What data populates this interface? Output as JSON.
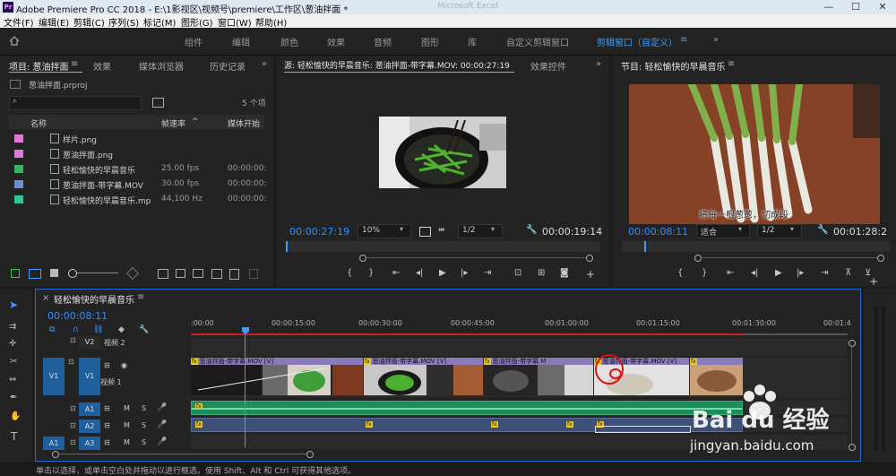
{
  "window": {
    "title": "Adobe Premiere Pro CC 2018 - E:\\1影视区\\视频号\\premiere\\工作区\\葱油拌面 *",
    "ghost_title": "Microsoft Excel",
    "app_icon": "Pr",
    "minimize": "—",
    "maximize": "☐",
    "close": "✕"
  },
  "menu": [
    "文件(F)",
    "编辑(E)",
    "剪辑(C)",
    "序列(S)",
    "标记(M)",
    "图形(G)",
    "窗口(W)",
    "帮助(H)"
  ],
  "workspaces": {
    "home_icon": "home-icon",
    "items": [
      "组件",
      "编辑",
      "颜色",
      "效果",
      "音频",
      "图形",
      "库",
      "自定义剪辑窗口",
      "剪辑窗口（自定义）"
    ],
    "active": "剪辑窗口（自定义）",
    "menu_glyph": "≡",
    "more": "»"
  },
  "project_panel": {
    "tabs": [
      "项目: 葱油拌面",
      "效果",
      "媒体浏览器",
      "历史记录"
    ],
    "tab_menu": "≡",
    "more": "»",
    "project_file": "葱油拌面.prproj",
    "search_placeholder": "",
    "item_count": "5 个项",
    "columns": {
      "name": "名称",
      "framerate": "帧速率",
      "sort": "^",
      "media_start": "媒体开始"
    },
    "items": [
      {
        "color": "#e07ad9",
        "name": "样片.png",
        "fps": "",
        "start": ""
      },
      {
        "color": "#e07ad9",
        "name": "葱油拌面.png",
        "fps": "",
        "start": ""
      },
      {
        "color": "#3bb35c",
        "name": "轻松愉快的早晨音乐",
        "fps": "25.00 fps",
        "start": "00:00:00:"
      },
      {
        "color": "#6f8fd4",
        "name": "葱油拌面-带字幕.MOV",
        "fps": "30.00 fps",
        "start": "00:00:00:"
      },
      {
        "color": "#2fc79a",
        "name": "轻松愉快的早晨音乐.mp",
        "fps": "44,100 Hz",
        "start": "00:00:00:"
      }
    ]
  },
  "source_monitor": {
    "tab": "源: 轻松愉快的早晨音乐: 葱油拌面-带字幕.MOV: 00:00:27:19",
    "tab2": "效果控件",
    "more": "»",
    "timecode": "00:00:27:19",
    "zoom": "10%",
    "resolution": "1/2",
    "duration": "00:00:19:14"
  },
  "program_monitor": {
    "tab": "节目: 轻松愉快的早晨音乐",
    "menu": "≡",
    "timecode": "00:00:08:11",
    "fit": "适合",
    "resolution": "1/2",
    "duration": "00:01:28:2",
    "subtitle": "将每一根葱葱，切成段"
  },
  "timeline": {
    "tab": "轻松愉快的早晨音乐",
    "close": "×",
    "menu": "≡",
    "timecode": "00:00:08:11",
    "ruler": [
      ":00:00",
      "00:00:15:00",
      "00:00:30:00",
      "00:00:45:00",
      "00:01:00:00",
      "00:01:15:00",
      "00:01:30:00",
      "00:01:4"
    ],
    "tracks_video": [
      {
        "target": "",
        "name": "V2",
        "label": "视频 2"
      },
      {
        "target": "V1",
        "name": "V1",
        "label": "视频 1"
      }
    ],
    "tracks_audio": [
      {
        "target": "",
        "name": "A1",
        "m": "M",
        "s": "S"
      },
      {
        "target": "",
        "name": "A2",
        "m": "M",
        "s": "S"
      },
      {
        "target": "A1",
        "name": "A3",
        "m": "M",
        "s": "S"
      }
    ],
    "clip_label": "葱油拌面-带字幕.MOV [V]",
    "clip_label_short": "葱油拌面-带字幕.M",
    "fx_tag": "fx"
  },
  "status_bar": "单击以选择，或单击空白处并拖动以进行框选。使用 Shift、Alt 和 Ctrl 可获得其他选项。",
  "watermark": {
    "logo": "Bai du 经验",
    "url": "jingyan.baidu.com"
  }
}
